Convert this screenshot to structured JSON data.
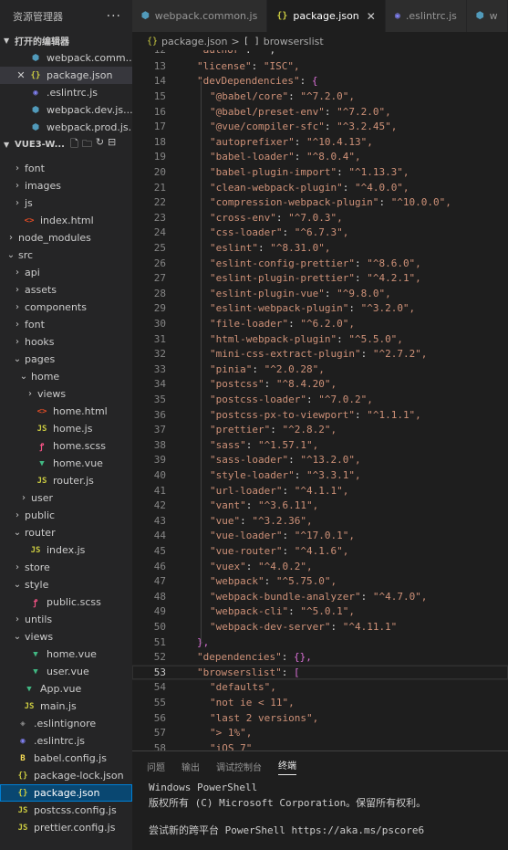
{
  "sidebar": {
    "title": "资源管理器",
    "more": "···",
    "open_editors_header": "打开的编辑器",
    "project_header": "VUE3-W...",
    "open_editors": [
      {
        "label": "webpack.comm...",
        "icon": "webpack-icon"
      },
      {
        "label": "package.json",
        "icon": "json-icon",
        "close": "✕"
      },
      {
        "label": ".eslintrc.js",
        "icon": "eslint-icon"
      },
      {
        "label": "webpack.dev.js...",
        "icon": "webpack-icon"
      },
      {
        "label": "webpack.prod.js...",
        "icon": "webpack-icon"
      }
    ],
    "tree": [
      {
        "label": "font",
        "type": "folder"
      },
      {
        "label": "images",
        "type": "folder"
      },
      {
        "label": "js",
        "type": "folder"
      },
      {
        "label": "index.html",
        "type": "html"
      },
      {
        "label": "node_modules",
        "type": "folder"
      },
      {
        "label": "src",
        "type": "folder-open"
      },
      {
        "label": "api",
        "type": "folder"
      },
      {
        "label": "assets",
        "type": "folder"
      },
      {
        "label": "components",
        "type": "folder"
      },
      {
        "label": "font",
        "type": "folder"
      },
      {
        "label": "hooks",
        "type": "folder"
      },
      {
        "label": "pages",
        "type": "folder-open"
      },
      {
        "label": "home",
        "type": "folder-open"
      },
      {
        "label": "views",
        "type": "folder"
      },
      {
        "label": "home.html",
        "type": "html"
      },
      {
        "label": "home.js",
        "type": "js"
      },
      {
        "label": "home.scss",
        "type": "scss"
      },
      {
        "label": "home.vue",
        "type": "vue"
      },
      {
        "label": "router.js",
        "type": "js"
      },
      {
        "label": "user",
        "type": "folder"
      },
      {
        "label": "public",
        "type": "folder"
      },
      {
        "label": "router",
        "type": "folder-open"
      },
      {
        "label": "index.js",
        "type": "js"
      },
      {
        "label": "store",
        "type": "folder"
      },
      {
        "label": "style",
        "type": "folder-open"
      },
      {
        "label": "public.scss",
        "type": "scss"
      },
      {
        "label": "untils",
        "type": "folder"
      },
      {
        "label": "views",
        "type": "folder-open"
      },
      {
        "label": "home.vue",
        "type": "vue"
      },
      {
        "label": "user.vue",
        "type": "vue"
      },
      {
        "label": "App.vue",
        "type": "vue"
      },
      {
        "label": "main.js",
        "type": "js"
      },
      {
        "label": ".eslintignore",
        "type": "git"
      },
      {
        "label": ".eslintrc.js",
        "type": "eslint"
      },
      {
        "label": "babel.config.js",
        "type": "babel"
      },
      {
        "label": "package-lock.json",
        "type": "json"
      },
      {
        "label": "package.json",
        "type": "json"
      },
      {
        "label": "postcss.config.js",
        "type": "js"
      },
      {
        "label": "prettier.config.js",
        "type": "js"
      }
    ]
  },
  "tabs": [
    {
      "label": "webpack.common.js",
      "icon": "webpack-icon"
    },
    {
      "label": "package.json",
      "icon": "json-icon",
      "active": true,
      "close": "✕"
    },
    {
      "label": ".eslintrc.js",
      "icon": "eslint-icon"
    },
    {
      "label": "w",
      "icon": "webpack-icon"
    }
  ],
  "breadcrumb": {
    "file": "package.json",
    "sep": ">",
    "node": "browserslist"
  },
  "code": [
    {
      "n": "13",
      "k": "\"license\"",
      "v": "\"ISC\","
    },
    {
      "n": "14",
      "k": "\"devDependencies\"",
      "open": "{"
    },
    {
      "n": "15",
      "k": "\"@babel/core\"",
      "v": "\"^7.2.0\","
    },
    {
      "n": "16",
      "k": "\"@babel/preset-env\"",
      "v": "\"^7.2.0\","
    },
    {
      "n": "17",
      "k": "\"@vue/compiler-sfc\"",
      "v": "\"^3.2.45\","
    },
    {
      "n": "18",
      "k": "\"autoprefixer\"",
      "v": "\"^10.4.13\","
    },
    {
      "n": "19",
      "k": "\"babel-loader\"",
      "v": "\"^8.0.4\","
    },
    {
      "n": "20",
      "k": "\"babel-plugin-import\"",
      "v": "\"^1.13.3\","
    },
    {
      "n": "21",
      "k": "\"clean-webpack-plugin\"",
      "v": "\"^4.0.0\","
    },
    {
      "n": "22",
      "k": "\"compression-webpack-plugin\"",
      "v": "\"^10.0.0\","
    },
    {
      "n": "23",
      "k": "\"cross-env\"",
      "v": "\"^7.0.3\","
    },
    {
      "n": "24",
      "k": "\"css-loader\"",
      "v": "\"^6.7.3\","
    },
    {
      "n": "25",
      "k": "\"eslint\"",
      "v": "\"^8.31.0\","
    },
    {
      "n": "26",
      "k": "\"eslint-config-prettier\"",
      "v": "\"^8.6.0\","
    },
    {
      "n": "27",
      "k": "\"eslint-plugin-prettier\"",
      "v": "\"^4.2.1\","
    },
    {
      "n": "28",
      "k": "\"eslint-plugin-vue\"",
      "v": "\"^9.8.0\","
    },
    {
      "n": "29",
      "k": "\"eslint-webpack-plugin\"",
      "v": "\"^3.2.0\","
    },
    {
      "n": "30",
      "k": "\"file-loader\"",
      "v": "\"^6.2.0\","
    },
    {
      "n": "31",
      "k": "\"html-webpack-plugin\"",
      "v": "\"^5.5.0\","
    },
    {
      "n": "32",
      "k": "\"mini-css-extract-plugin\"",
      "v": "\"^2.7.2\","
    },
    {
      "n": "33",
      "k": "\"pinia\"",
      "v": "\"^2.0.28\","
    },
    {
      "n": "34",
      "k": "\"postcss\"",
      "v": "\"^8.4.20\","
    },
    {
      "n": "35",
      "k": "\"postcss-loader\"",
      "v": "\"^7.0.2\","
    },
    {
      "n": "36",
      "k": "\"postcss-px-to-viewport\"",
      "v": "\"^1.1.1\","
    },
    {
      "n": "37",
      "k": "\"prettier\"",
      "v": "\"^2.8.2\","
    },
    {
      "n": "38",
      "k": "\"sass\"",
      "v": "\"^1.57.1\","
    },
    {
      "n": "39",
      "k": "\"sass-loader\"",
      "v": "\"^13.2.0\","
    },
    {
      "n": "40",
      "k": "\"style-loader\"",
      "v": "\"^3.3.1\","
    },
    {
      "n": "41",
      "k": "\"url-loader\"",
      "v": "\"^4.1.1\","
    },
    {
      "n": "42",
      "k": "\"vant\"",
      "v": "\"^3.6.11\","
    },
    {
      "n": "43",
      "k": "\"vue\"",
      "v": "\"^3.2.36\","
    },
    {
      "n": "44",
      "k": "\"vue-loader\"",
      "v": "\"^17.0.1\","
    },
    {
      "n": "45",
      "k": "\"vue-router\"",
      "v": "\"^4.1.6\","
    },
    {
      "n": "46",
      "k": "\"vuex\"",
      "v": "\"^4.0.2\","
    },
    {
      "n": "47",
      "k": "\"webpack\"",
      "v": "\"^5.75.0\","
    },
    {
      "n": "48",
      "k": "\"webpack-bundle-analyzer\"",
      "v": "\"^4.7.0\","
    },
    {
      "n": "49",
      "k": "\"webpack-cli\"",
      "v": "\"^5.0.1\","
    },
    {
      "n": "50",
      "k": "\"webpack-dev-server\"",
      "v": "\"^4.11.1\""
    },
    {
      "n": "51",
      "close": "},"
    },
    {
      "n": "52",
      "k": "\"dependencies\"",
      "obj": "{},"
    },
    {
      "n": "53",
      "k": "\"browserslist\"",
      "open": "[",
      "cur": true
    },
    {
      "n": "54",
      "item": "\"defaults\","
    },
    {
      "n": "55",
      "item": "\"not ie < 11\","
    },
    {
      "n": "56",
      "item": "\"last 2 versions\","
    },
    {
      "n": "57",
      "item": "\"> 1%\","
    },
    {
      "n": "58",
      "item": "\"iOS 7\""
    }
  ],
  "panel": {
    "tabs": [
      "问题",
      "输出",
      "调试控制台",
      "终端"
    ],
    "active_tab": "终端",
    "terminal": [
      "Windows PowerShell",
      "版权所有 (C) Microsoft Corporation。保留所有权利。",
      "",
      "尝试新的跨平台 PowerShell https://aka.ms/pscore6"
    ]
  },
  "colors": {
    "accent": "#007fd4",
    "string": "#ce9178",
    "bracket1": "#da70d6",
    "bracket2": "#ffd700"
  }
}
